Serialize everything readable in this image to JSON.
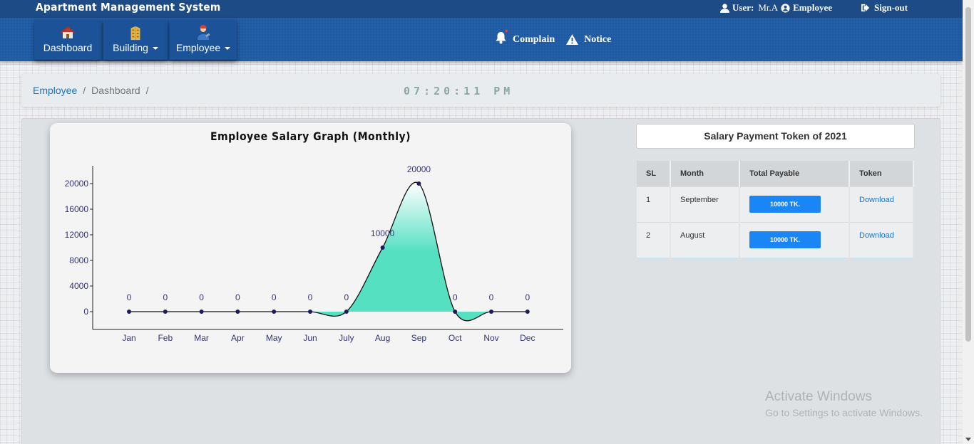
{
  "app": {
    "title": "Apartment Management System"
  },
  "user": {
    "label": "User:",
    "name": "Mr.A",
    "role": "Employee",
    "signout": "Sign-out"
  },
  "nav": {
    "dashboard": "Dashboard",
    "building": "Building",
    "employee": "Employee",
    "complain": "Complain",
    "notice": "Notice"
  },
  "breadcrumb": {
    "root": "Employee",
    "current": "Dashboard"
  },
  "clock": "07:20:11 PM",
  "chart_data": {
    "type": "area",
    "title": "Employee Salary Graph (Monthly)",
    "categories": [
      "Jan",
      "Feb",
      "Mar",
      "Apr",
      "May",
      "Jun",
      "July",
      "Aug",
      "Sep",
      "Oct",
      "Nov",
      "Dec"
    ],
    "values": [
      0,
      0,
      0,
      0,
      0,
      0,
      0,
      10000,
      20000,
      0,
      0,
      0
    ],
    "ylim": [
      0,
      20000
    ],
    "yticks": [
      0,
      4000,
      8000,
      12000,
      16000,
      20000
    ],
    "xlabel": "",
    "ylabel": "",
    "grid": false,
    "colors": {
      "fill": "#55e0c2",
      "fill_top": "#ffffff",
      "line": "#111111",
      "point": "#1b1b5e",
      "label": "#33337a"
    }
  },
  "token": {
    "title": "Salary Payment Token of 2021",
    "headers": [
      "SL",
      "Month",
      "Total Payable",
      "Token"
    ],
    "rows": [
      {
        "sl": "1",
        "month": "September",
        "amount": "10000 TK.",
        "token": "Download"
      },
      {
        "sl": "2",
        "month": "August",
        "amount": "10000 TK.",
        "token": "Download"
      }
    ]
  },
  "watermark": {
    "line1": "Activate Windows",
    "line2": "Go to Settings to activate Windows."
  }
}
